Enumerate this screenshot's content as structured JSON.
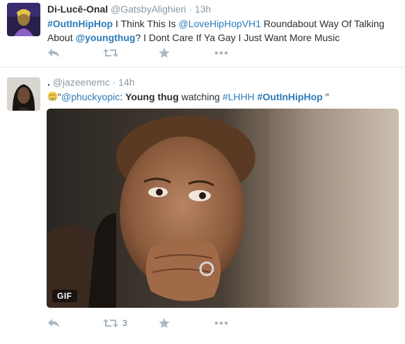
{
  "tweets": [
    {
      "fullname": "Di-Lucē-Onal",
      "username": "@GatsbyAlighieri",
      "separator": "·",
      "time": "13h",
      "text_parts": {
        "p1": "#OutInHipHop",
        "p2": " I Think This Is ",
        "p3": "@LoveHipHopVH1",
        "p4": " Roundabout Way Of Talking About ",
        "p5": "@youngthug",
        "p6": "? I Dont Care If Ya Gay I Just Want More Music"
      },
      "actions": {
        "reply_icon": "reply-icon",
        "retweet_icon": "retweet-icon",
        "favorite_icon": "star-icon",
        "more_icon": "more-icon",
        "retweet_count": ""
      }
    },
    {
      "fullname": ".",
      "username": "@jazeenemc",
      "separator": "·",
      "time": "14h",
      "text_parts": {
        "emoji": "crying-face-emoji",
        "p1": "\"",
        "p2": "@phuckyopic",
        "p3": ": ",
        "p4": "Young thug",
        "p5": " watching ",
        "p6": "#LHHH",
        "p7": " ",
        "p8": "#OutInHipHop",
        "p9": " \""
      },
      "media": {
        "badge": "GIF"
      },
      "actions": {
        "reply_icon": "reply-icon",
        "retweet_icon": "retweet-icon",
        "favorite_icon": "star-icon",
        "more_icon": "more-icon",
        "retweet_count": "3"
      }
    }
  ],
  "colors": {
    "link": "#2b7bb9",
    "meta": "#8899a6",
    "text": "#292f33",
    "icon": "#aab8c2",
    "divider": "#e1e8ed"
  }
}
